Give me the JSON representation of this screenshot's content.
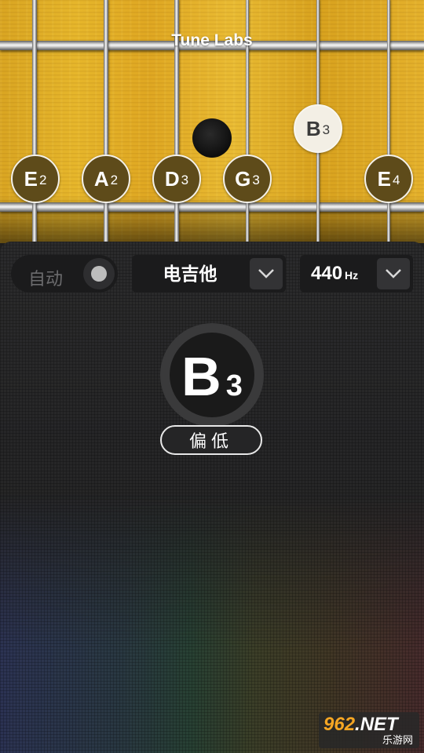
{
  "header": {
    "title": "Tune Labs"
  },
  "strings": [
    {
      "letter": "E",
      "octave": "2",
      "active": false
    },
    {
      "letter": "A",
      "octave": "2",
      "active": false
    },
    {
      "letter": "D",
      "octave": "3",
      "active": false
    },
    {
      "letter": "G",
      "octave": "3",
      "active": false
    },
    {
      "letter": "B",
      "octave": "3",
      "active": true
    },
    {
      "letter": "E",
      "octave": "4",
      "active": false
    }
  ],
  "controls": {
    "auto_label": "自动",
    "instrument": "电吉他",
    "frequency_value": "440",
    "frequency_unit": "Hz"
  },
  "current_note": {
    "letter": "B",
    "octave": "3",
    "status": "偏低"
  },
  "watermark": {
    "main": "962",
    "suffix": ".NET",
    "sub": "乐游网"
  },
  "colors": {
    "wood": "#e0ad28",
    "panel": "#262627",
    "accent": "#f3efe5"
  }
}
